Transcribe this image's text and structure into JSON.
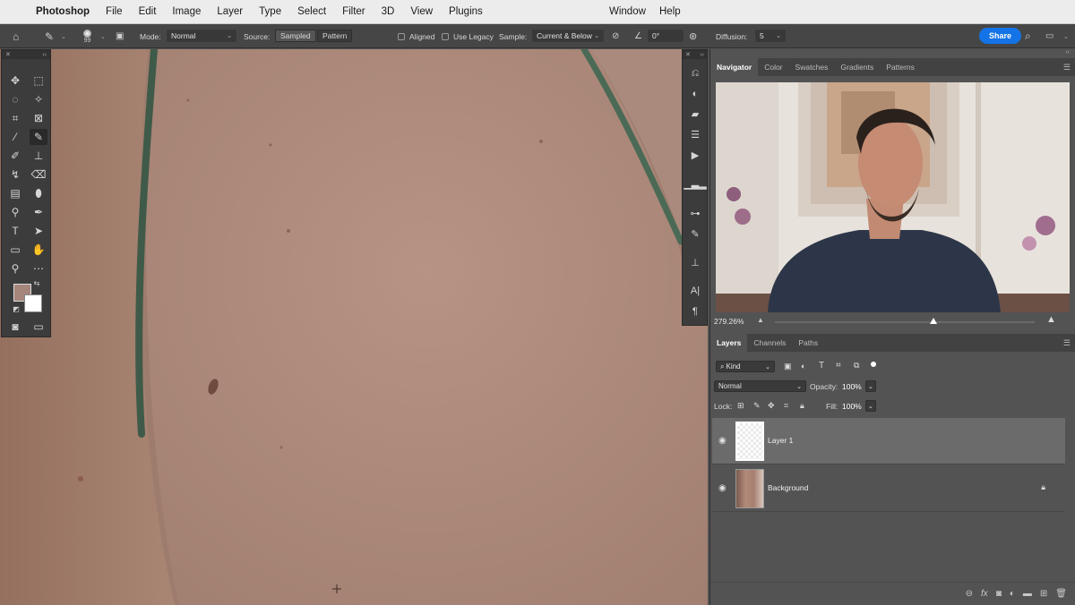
{
  "menubar": {
    "app_name": "Photoshop",
    "items": [
      "File",
      "Edit",
      "Image",
      "Layer",
      "Type",
      "Select",
      "Filter",
      "3D",
      "View",
      "Plugins"
    ],
    "window": "Window",
    "help": "Help"
  },
  "options": {
    "brush_size": "99",
    "mode_label": "Mode:",
    "mode_value": "Normal",
    "source_label": "Source:",
    "source_sampled": "Sampled",
    "source_pattern": "Pattern",
    "aligned": "Aligned",
    "use_legacy": "Use Legacy",
    "sample_label": "Sample:",
    "sample_value": "Current & Below",
    "angle_value": "0°",
    "diffusion_label": "Diffusion:",
    "diffusion_value": "5",
    "share": "Share"
  },
  "colors": {
    "foreground": "#a6857b",
    "background": "#ffffff",
    "accent": "#1473e6"
  },
  "navigator": {
    "tabs": [
      "Navigator",
      "Color",
      "Swatches",
      "Gradients",
      "Patterns"
    ],
    "zoom": "279.26%"
  },
  "layers": {
    "tabs": [
      "Layers",
      "Channels",
      "Paths"
    ],
    "kind_label": "Kind",
    "blend_mode": "Normal",
    "opacity_label": "Opacity:",
    "opacity_value": "100%",
    "lock_label": "Lock:",
    "fill_label": "Fill:",
    "fill_value": "100%",
    "items": [
      {
        "name": "Layer 1"
      },
      {
        "name": "Background"
      }
    ]
  }
}
